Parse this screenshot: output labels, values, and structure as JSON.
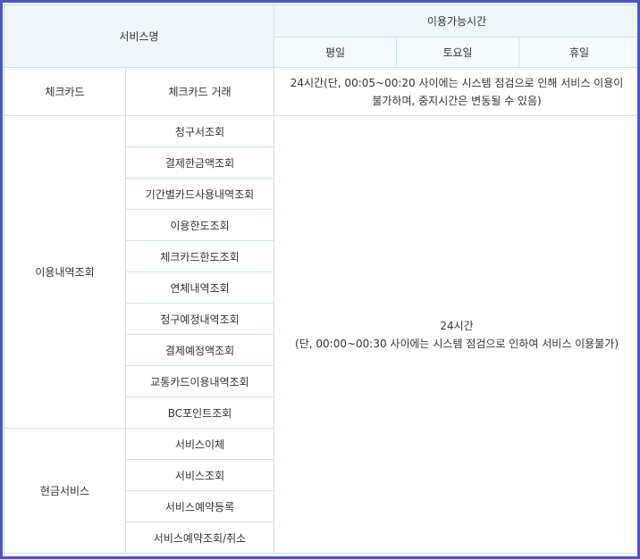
{
  "header": {
    "service_name": "서비스명",
    "available_time": "이용가능시간",
    "weekday": "평일",
    "saturday": "토요일",
    "holiday": "휴일"
  },
  "check_card": {
    "category": "체크카드",
    "service": "체크카드 거래",
    "time_line1": "24시간(단, 00:05~00:20 사이에는 시스템 점검으로 인해 서비스 이용이",
    "time_line2": "불가하며, 중지시간은 변동될 수 있음)"
  },
  "usage_inquiry": {
    "category": "이용내역조회",
    "items": [
      "청구서조회",
      "결제한금액조회",
      "기간별카드사용내역조회",
      "이용한도조회",
      "체크카드한도조회",
      "연체내역조회",
      "청구예정내역조회",
      "결제예정액조회",
      "교통카드이용내역조회",
      "BC포인트조회"
    ]
  },
  "cash_service": {
    "category": "현금서비스",
    "items": [
      "서비스이체",
      "서비스조회",
      "서비스예약등록",
      "서비스예약조회/취소"
    ]
  },
  "shared_time": {
    "line1": "24시간",
    "line2": "(단, 00:00~00:30 사이에는 시스템 점검으로 인하여 서비스 이용불가)"
  },
  "colors": {
    "frame": "#4a55c9",
    "header_bg": "#eef6fa",
    "subheader_bg": "#f5fbfd",
    "border": "#c9e3ef",
    "text": "#333333"
  }
}
